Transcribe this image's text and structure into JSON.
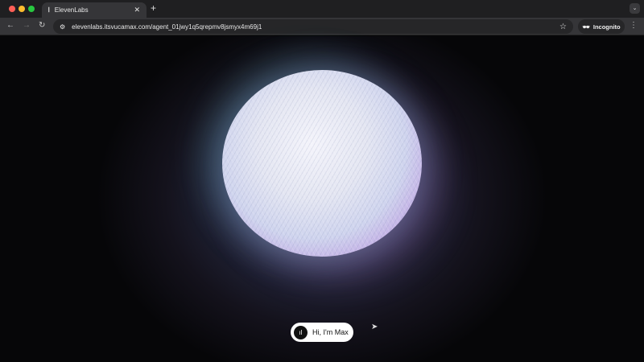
{
  "browser": {
    "tab_title": "ElevenLabs",
    "url": "elevenlabs.itsvucamax.com/agent_01jwy1q5qrepmv8jsmyx4m69j1",
    "incognito_label": "Incognito"
  },
  "page": {
    "greeting_label": "Hi, I'm Max"
  },
  "colors": {
    "close": "#ff5f57",
    "minimize": "#febc2e",
    "maximize": "#28c840"
  }
}
